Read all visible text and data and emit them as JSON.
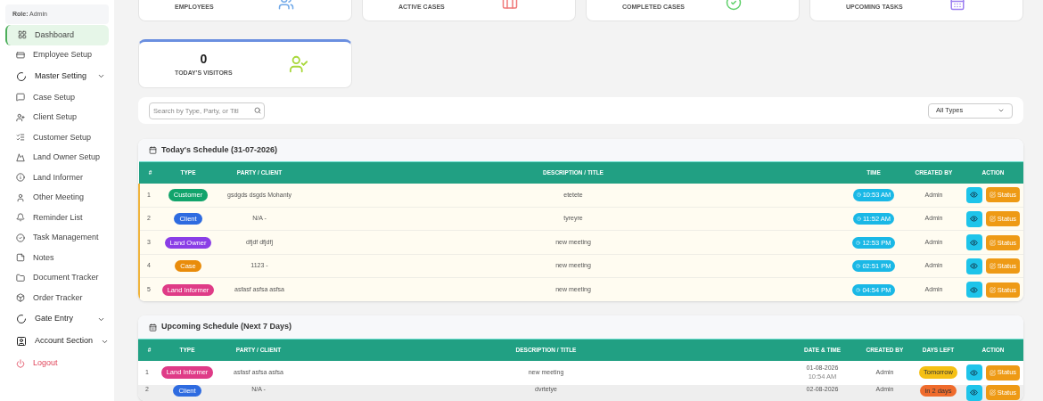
{
  "sidebar": {
    "role_label": "Role:",
    "role_value": "Admin",
    "items": [
      {
        "label": "Dashboard",
        "kind": "link",
        "selected": true
      },
      {
        "label": "Employee Setup",
        "kind": "link",
        "selected": false
      },
      {
        "label": "Master Setting",
        "kind": "group",
        "selected": false
      },
      {
        "label": "Case Setup",
        "kind": "link",
        "selected": false
      },
      {
        "label": "Client Setup",
        "kind": "link",
        "selected": false
      },
      {
        "label": "Customer Setup",
        "kind": "link",
        "selected": false
      },
      {
        "label": "Land Owner Setup",
        "kind": "link",
        "selected": false
      },
      {
        "label": "Land Informer",
        "kind": "link",
        "selected": false
      },
      {
        "label": "Other Meeting",
        "kind": "link",
        "selected": false
      },
      {
        "label": "Reminder List",
        "kind": "link",
        "selected": false
      },
      {
        "label": "Task Management",
        "kind": "link",
        "selected": false
      },
      {
        "label": "Notes",
        "kind": "link",
        "selected": false
      },
      {
        "label": "Document Tracker",
        "kind": "link",
        "selected": false
      },
      {
        "label": "Order Tracker",
        "kind": "link",
        "selected": false
      },
      {
        "label": "Gate Entry",
        "kind": "group",
        "selected": false
      },
      {
        "label": "Account Section",
        "kind": "group",
        "selected": false
      },
      {
        "label": "Logout",
        "kind": "danger",
        "selected": false
      }
    ]
  },
  "stat_cards": [
    {
      "label": "EMPLOYEES",
      "color": "#6fa8e8"
    },
    {
      "label": "ACTIVE CASES",
      "color": "#f07a7a"
    },
    {
      "label": "COMPLETED CASES",
      "color": "#5fd06a"
    },
    {
      "label": "UPCOMING TASKS",
      "color": "#9b7ef0"
    }
  ],
  "visitors_card": {
    "value": "0",
    "label": "TODAY'S VISITORS"
  },
  "search": {
    "placeholder": "Search by Type, Party, or Titl",
    "filter_value": "All Types"
  },
  "today": {
    "title": "Today's Schedule (31-07-2026)",
    "columns": [
      "#",
      "TYPE",
      "PARTY / CLIENT",
      "DESCRIPTION / TITLE",
      "TIME",
      "CREATED BY",
      "ACTION"
    ],
    "rows": [
      {
        "no": "1",
        "type": "Customer",
        "color": "#12a46c",
        "party": "gsdgds dsgds Mohanty",
        "description": "etetete",
        "time": "10:53 AM",
        "created_by": "Admin",
        "action": "Status"
      },
      {
        "no": "2",
        "type": "Client",
        "color": "#2e6be0",
        "party": "N/A -",
        "description": "tyreyre",
        "time": "11:52 AM",
        "created_by": "Admin",
        "action": "Status"
      },
      {
        "no": "3",
        "type": "Land Owner",
        "color": "#8a3ee6",
        "party": "dfjdf dfjdfj",
        "description": "new meeting",
        "time": "12:53 PM",
        "created_by": "Admin",
        "action": "Status"
      },
      {
        "no": "4",
        "type": "Case",
        "color": "#e98c0b",
        "party": "1123 -",
        "description": "new meeting",
        "time": "02:51 PM",
        "created_by": "Admin",
        "action": "Status"
      },
      {
        "no": "5",
        "type": "Land Informer",
        "color": "#df3b87",
        "party": "asfasf asfsa asfsa",
        "description": "new meeting",
        "time": "04:54 PM",
        "created_by": "Admin",
        "action": "Status"
      }
    ]
  },
  "upcoming": {
    "title": "Upcoming Schedule (Next 7 Days)",
    "columns": [
      "#",
      "TYPE",
      "PARTY / CLIENT",
      "DESCRIPTION / TITLE",
      "DATE & TIME",
      "CREATED BY",
      "DAYS LEFT",
      "ACTION"
    ],
    "rows": [
      {
        "no": "1",
        "type": "Land Informer",
        "color": "#df3b87",
        "party": "asfasf asfsa asfsa",
        "description": "new meeting",
        "date": "01-08-2026",
        "time": "10:54 AM",
        "created_by": "Admin",
        "days_left": {
          "label": "Tomorrow",
          "color": "#f5c014"
        },
        "action": "Status"
      },
      {
        "no": "2",
        "type": "Client",
        "color": "#2e6be0",
        "party": "N/A -",
        "description": "dvrtetye",
        "date": "02-08-2026",
        "created_by": "Admin",
        "days_left": {
          "label": "in 2 days",
          "color": "#ef6b2c"
        },
        "action": "Status"
      }
    ]
  }
}
